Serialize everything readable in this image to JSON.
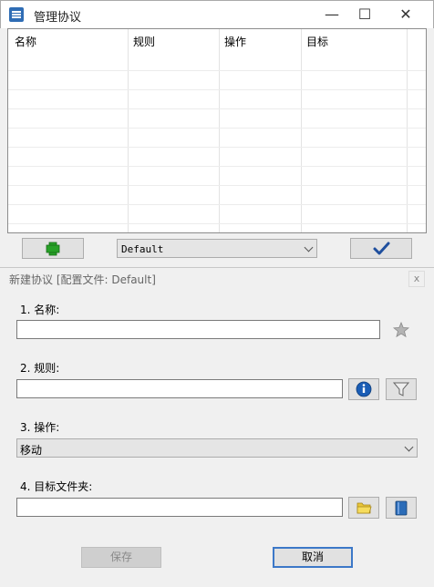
{
  "window": {
    "title": "管理协议",
    "minimize": "—",
    "maximize": "☐",
    "close": "✕"
  },
  "grid": {
    "columns": [
      "名称",
      "规则",
      "操作",
      "目标"
    ]
  },
  "toolbar": {
    "add_icon": "plus-icon",
    "profile_value": "Default",
    "confirm_icon": "checkmark-icon"
  },
  "panel": {
    "title": "新建协议 [配置文件: Default]",
    "close": "x",
    "name_label": "1. 名称:",
    "name_value": "",
    "rule_label": "2. 规则:",
    "rule_value": "",
    "action_label": "3. 操作:",
    "action_value": "移动",
    "target_label": "4. 目标文件夹:",
    "target_value": "",
    "save_label": "保存",
    "cancel_label": "取消"
  },
  "colors": {
    "accent": "#3c78c8",
    "info": "#1a5db5",
    "add": "#27a127"
  }
}
